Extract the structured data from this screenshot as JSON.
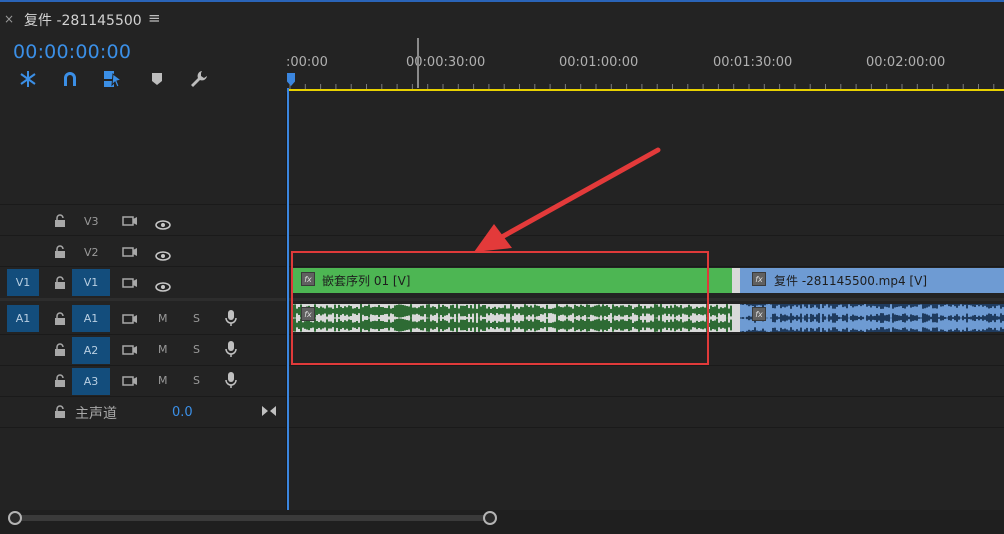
{
  "sequence": {
    "tab_title": "复件 -281145500",
    "close_glyph": "×",
    "menu_glyph": "≡",
    "timecode": "00:00:00:00"
  },
  "toolbar": {
    "tools": [
      "snap-insert-icon",
      "magnet-snap-icon",
      "linked-selection-icon",
      "add-marker-icon",
      "wrench-settings-icon"
    ]
  },
  "ruler": {
    "labels": [
      ":00:00",
      "00:00:30:00",
      "00:01:00:00",
      "00:01:30:00",
      "00:02:00:00"
    ]
  },
  "tracks": {
    "v3": {
      "label": "V3"
    },
    "v2": {
      "label": "V2"
    },
    "v1": {
      "source": "V1",
      "label": "V1"
    },
    "a1": {
      "source": "A1",
      "label": "A1",
      "mute": "M",
      "solo": "S"
    },
    "a2": {
      "label": "A2",
      "mute": "M",
      "solo": "S"
    },
    "a3": {
      "label": "A3",
      "mute": "M",
      "solo": "S"
    },
    "master": {
      "label": "主声道",
      "volume": "0.0"
    }
  },
  "clips": {
    "nested": {
      "label": "嵌套序列 01 [V]",
      "fx": "fx"
    },
    "copy": {
      "label": "复件 -281145500.mp4 [V]",
      "fx": "fx"
    }
  },
  "colors": {
    "accent": "#3b86df",
    "green_clip": "#4db653",
    "blue_clip": "#6e9bd3",
    "highlight_box": "#e03a3a",
    "arrow": "#e33a3a",
    "work_area": "#e8d100"
  }
}
